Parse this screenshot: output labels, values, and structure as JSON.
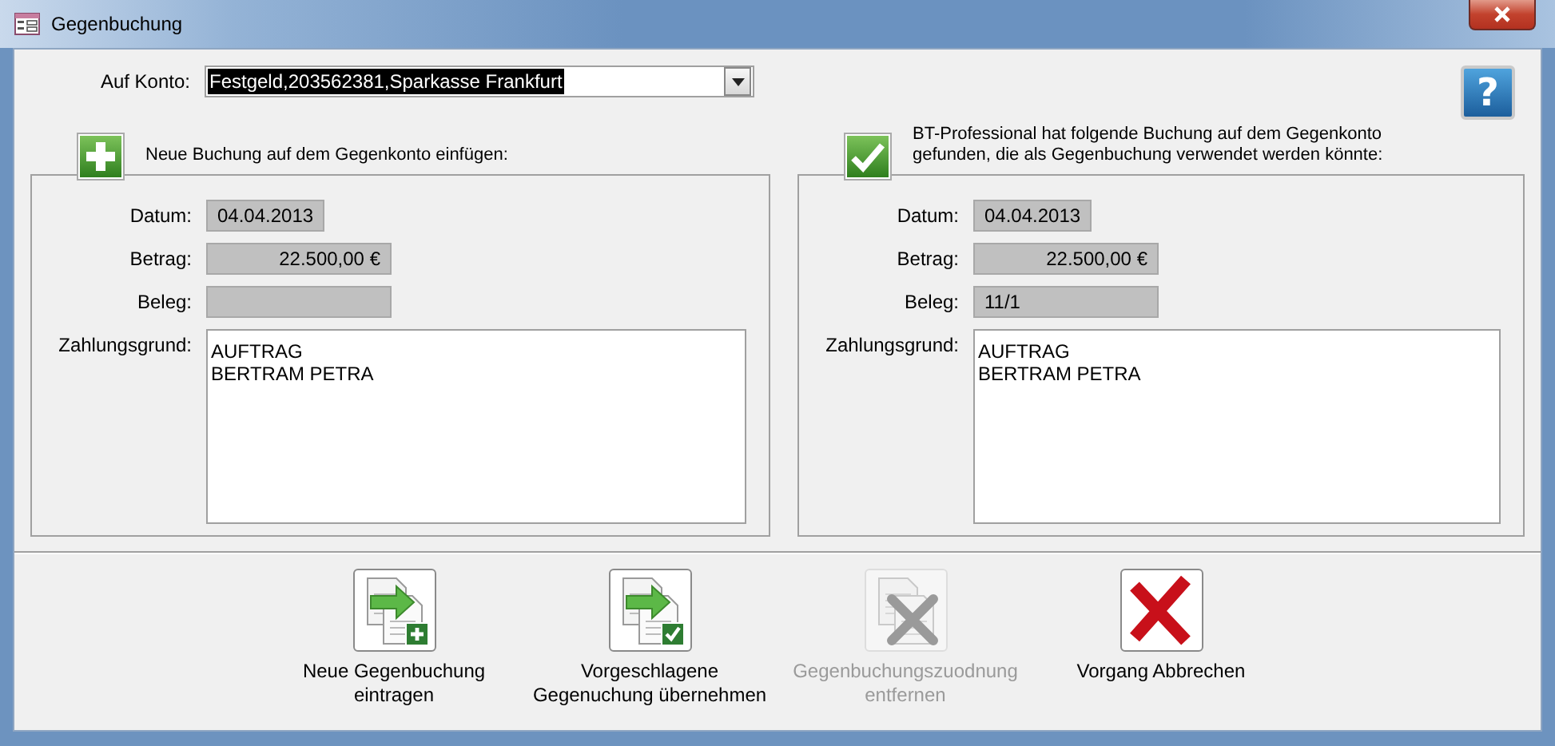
{
  "window": {
    "title": "Gegenbuchung"
  },
  "account": {
    "label": "Auf Konto:",
    "value": "Festgeld,203562381,Sparkasse Frankfurt",
    "text_selected": true
  },
  "help_button": {
    "label": "?"
  },
  "panels": [
    {
      "kind": "new",
      "caption": "Neue Buchung auf dem Gegenkonto einfügen:",
      "fields": [
        {
          "kind": "date",
          "label": "Datum:",
          "value": "04.04.2013"
        },
        {
          "kind": "amount",
          "label": "Betrag:",
          "value": "22.500,00 €"
        },
        {
          "kind": "text",
          "label": "Beleg:"
        }
      ],
      "reason": {
        "label": "Zahlungsgrund:",
        "lines": [
          "AUFTRAG",
          "BERTRAM PETRA"
        ]
      }
    },
    {
      "kind": "found",
      "caption": "BT-Professional hat folgende Buchung auf dem Gegenkonto gefunden, die als Gegenbuchung verwendet werden könnte:",
      "fields": [
        {
          "kind": "date",
          "label": "Datum:",
          "value": "04.04.2013"
        },
        {
          "kind": "amount",
          "label": "Betrag:",
          "value": "22.500,00 €"
        },
        {
          "kind": "text",
          "label": "Beleg:",
          "value": "11/1"
        }
      ],
      "reason": {
        "label": "Zahlungsgrund:",
        "lines": [
          "AUFTRAG",
          "BERTRAM PETRA"
        ]
      }
    }
  ],
  "actions": [
    {
      "kind": "add",
      "lines": [
        "Neue Gegenbuchung",
        "eintragen"
      ],
      "disabled": false
    },
    {
      "kind": "accept",
      "lines": [
        "Vorgeschlagene",
        "Gegenuchung übernehmen"
      ],
      "disabled": false
    },
    {
      "kind": "remove",
      "lines": [
        "Gegenbuchungszuodnung",
        "entfernen"
      ],
      "disabled": true
    },
    {
      "kind": "cancel",
      "lines": [
        "Vorgang Abbrechen"
      ],
      "disabled": false
    }
  ]
}
